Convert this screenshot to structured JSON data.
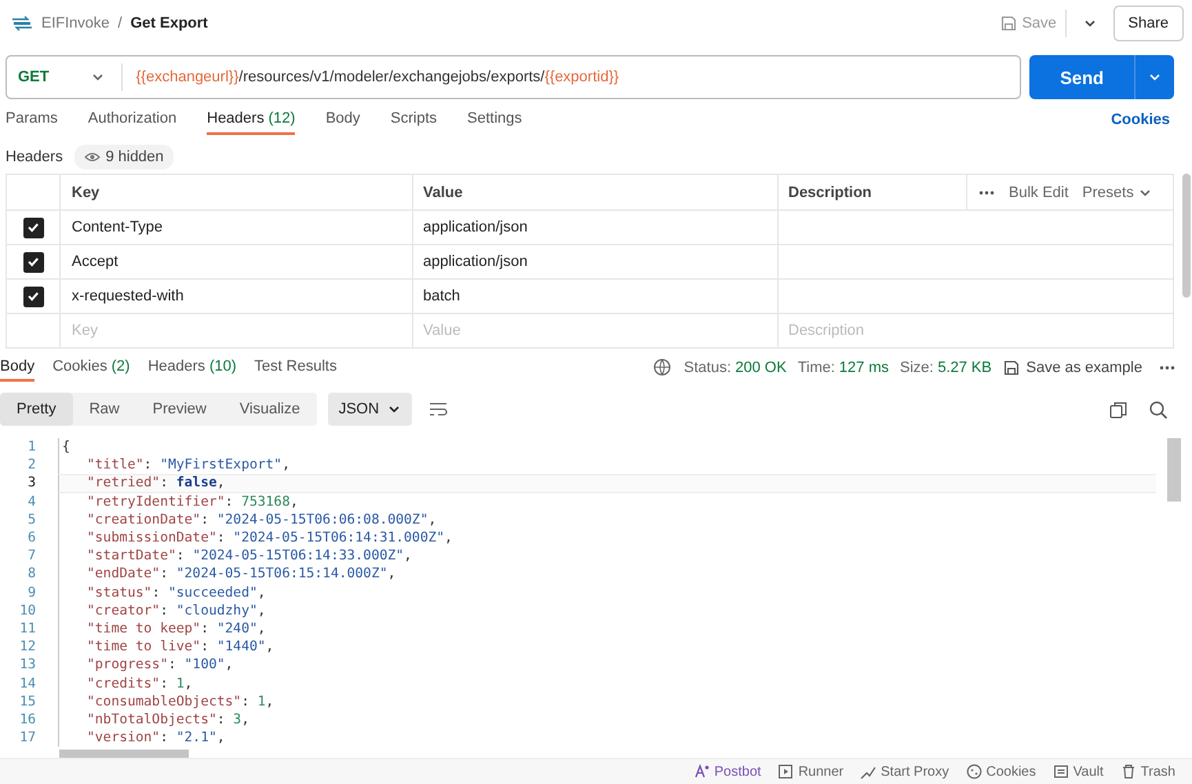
{
  "breadcrumb": {
    "collection": "EIFInvoke",
    "separator": "/",
    "request": "Get Export"
  },
  "header_actions": {
    "save": "Save",
    "share": "Share"
  },
  "request": {
    "method": "GET",
    "url": [
      {
        "kind": "variable",
        "text": "{{exchangeurl}}"
      },
      {
        "kind": "path",
        "text": "/resources/v1/modeler/exchangejobs/exports/"
      },
      {
        "kind": "variable",
        "text": "{{exportid}}"
      }
    ],
    "send": "Send"
  },
  "request_tabs": [
    {
      "label": "Params",
      "selected": false
    },
    {
      "label": "Authorization",
      "selected": false
    },
    {
      "label": "Headers",
      "count": "(12)",
      "selected": true
    },
    {
      "label": "Body",
      "selected": false
    },
    {
      "label": "Scripts",
      "selected": false
    },
    {
      "label": "Settings",
      "selected": false
    }
  ],
  "cookies_link": "Cookies",
  "headers": {
    "label": "Headers",
    "hidden": "9 hidden",
    "columns": [
      "Key",
      "Value",
      "Description"
    ],
    "bulk_edit": "Bulk Edit",
    "presets": "Presets",
    "rows": [
      {
        "checked": true,
        "key": "Content-Type",
        "value": "application/json"
      },
      {
        "checked": true,
        "key": "Accept",
        "value": "application/json"
      },
      {
        "checked": true,
        "key": "x-requested-with",
        "value": "batch"
      }
    ],
    "new_row": [
      {
        "placeholder": "Key"
      },
      {
        "placeholder": "Value"
      },
      {
        "placeholder": "Description"
      }
    ]
  },
  "response_tabs": [
    {
      "label": "Body",
      "selected": true
    },
    {
      "label": "Cookies",
      "count": "(2)",
      "selected": false
    },
    {
      "label": "Headers",
      "count": "(10)",
      "selected": false
    },
    {
      "label": "Test Results",
      "selected": false
    }
  ],
  "response_meta": [
    {
      "label": "Status:",
      "value": "200 OK"
    },
    {
      "label": "Time:",
      "value": "127 ms"
    },
    {
      "label": "Size:",
      "value": "5.27 KB"
    }
  ],
  "save_example": "Save as example",
  "view_modes": [
    {
      "label": "Pretty",
      "selected": true
    },
    {
      "label": "Raw",
      "selected": false
    },
    {
      "label": "Preview",
      "selected": false
    },
    {
      "label": "Visualize",
      "selected": false
    }
  ],
  "format": "JSON",
  "code_lines": [
    {
      "number": "1",
      "selected": false,
      "parts": [
        {
          "kind": "punct",
          "text": "{"
        }
      ]
    },
    {
      "number": "2",
      "selected": false,
      "parts": [
        {
          "kind": "key",
          "text": "\"title\""
        },
        {
          "kind": "punct",
          "text": ": "
        },
        {
          "kind": "string",
          "text": "\"MyFirstExport\""
        },
        {
          "kind": "punct",
          "text": ","
        }
      ]
    },
    {
      "number": "3",
      "selected": true,
      "parts": [
        {
          "kind": "key",
          "text": "\"retried\""
        },
        {
          "kind": "punct",
          "text": ": "
        },
        {
          "kind": "boolean",
          "text": "false"
        },
        {
          "kind": "punct",
          "text": ","
        }
      ]
    },
    {
      "number": "4",
      "selected": false,
      "parts": [
        {
          "kind": "key",
          "text": "\"retryIdentifier\""
        },
        {
          "kind": "punct",
          "text": ": "
        },
        {
          "kind": "number",
          "text": "753168"
        },
        {
          "kind": "punct",
          "text": ","
        }
      ]
    },
    {
      "number": "5",
      "selected": false,
      "parts": [
        {
          "kind": "key",
          "text": "\"creationDate\""
        },
        {
          "kind": "punct",
          "text": ": "
        },
        {
          "kind": "string",
          "text": "\"2024-05-15T06:06:08.000Z\""
        },
        {
          "kind": "punct",
          "text": ","
        }
      ]
    },
    {
      "number": "6",
      "selected": false,
      "parts": [
        {
          "kind": "key",
          "text": "\"submissionDate\""
        },
        {
          "kind": "punct",
          "text": ": "
        },
        {
          "kind": "string",
          "text": "\"2024-05-15T06:14:31.000Z\""
        },
        {
          "kind": "punct",
          "text": ","
        }
      ]
    },
    {
      "number": "7",
      "selected": false,
      "parts": [
        {
          "kind": "key",
          "text": "\"startDate\""
        },
        {
          "kind": "punct",
          "text": ": "
        },
        {
          "kind": "string",
          "text": "\"2024-05-15T06:14:33.000Z\""
        },
        {
          "kind": "punct",
          "text": ","
        }
      ]
    },
    {
      "number": "8",
      "selected": false,
      "parts": [
        {
          "kind": "key",
          "text": "\"endDate\""
        },
        {
          "kind": "punct",
          "text": ": "
        },
        {
          "kind": "string",
          "text": "\"2024-05-15T06:15:14.000Z\""
        },
        {
          "kind": "punct",
          "text": ","
        }
      ]
    },
    {
      "number": "9",
      "selected": false,
      "parts": [
        {
          "kind": "key",
          "text": "\"status\""
        },
        {
          "kind": "punct",
          "text": ": "
        },
        {
          "kind": "string",
          "text": "\"succeeded\""
        },
        {
          "kind": "punct",
          "text": ","
        }
      ]
    },
    {
      "number": "10",
      "selected": false,
      "parts": [
        {
          "kind": "key",
          "text": "\"creator\""
        },
        {
          "kind": "punct",
          "text": ": "
        },
        {
          "kind": "string",
          "text": "\"cloudzhy\""
        },
        {
          "kind": "punct",
          "text": ","
        }
      ]
    },
    {
      "number": "11",
      "selected": false,
      "parts": [
        {
          "kind": "key",
          "text": "\"time to keep\""
        },
        {
          "kind": "punct",
          "text": ": "
        },
        {
          "kind": "string",
          "text": "\"240\""
        },
        {
          "kind": "punct",
          "text": ","
        }
      ]
    },
    {
      "number": "12",
      "selected": false,
      "parts": [
        {
          "kind": "key",
          "text": "\"time to live\""
        },
        {
          "kind": "punct",
          "text": ": "
        },
        {
          "kind": "string",
          "text": "\"1440\""
        },
        {
          "kind": "punct",
          "text": ","
        }
      ]
    },
    {
      "number": "13",
      "selected": false,
      "parts": [
        {
          "kind": "key",
          "text": "\"progress\""
        },
        {
          "kind": "punct",
          "text": ": "
        },
        {
          "kind": "string",
          "text": "\"100\""
        },
        {
          "kind": "punct",
          "text": ","
        }
      ]
    },
    {
      "number": "14",
      "selected": false,
      "parts": [
        {
          "kind": "key",
          "text": "\"credits\""
        },
        {
          "kind": "punct",
          "text": ": "
        },
        {
          "kind": "number",
          "text": "1"
        },
        {
          "kind": "punct",
          "text": ","
        }
      ]
    },
    {
      "number": "15",
      "selected": false,
      "parts": [
        {
          "kind": "key",
          "text": "\"consumableObjects\""
        },
        {
          "kind": "punct",
          "text": ": "
        },
        {
          "kind": "number",
          "text": "1"
        },
        {
          "kind": "punct",
          "text": ","
        }
      ]
    },
    {
      "number": "16",
      "selected": false,
      "parts": [
        {
          "kind": "key",
          "text": "\"nbTotalObjects\""
        },
        {
          "kind": "punct",
          "text": ": "
        },
        {
          "kind": "number",
          "text": "3"
        },
        {
          "kind": "punct",
          "text": ","
        }
      ]
    },
    {
      "number": "17",
      "selected": false,
      "parts": [
        {
          "kind": "key",
          "text": "\"version\""
        },
        {
          "kind": "punct",
          "text": ": "
        },
        {
          "kind": "string",
          "text": "\"2.1\""
        },
        {
          "kind": "punct",
          "text": ","
        }
      ]
    }
  ],
  "status_bar": [
    {
      "kind": "postbot",
      "label": "Postbot"
    },
    {
      "kind": "runner",
      "label": "Runner"
    },
    {
      "kind": "proxy",
      "label": "Start Proxy"
    },
    {
      "kind": "cookies",
      "label": "Cookies"
    },
    {
      "kind": "vault",
      "label": "Vault"
    },
    {
      "kind": "trash",
      "label": "Trash"
    }
  ]
}
